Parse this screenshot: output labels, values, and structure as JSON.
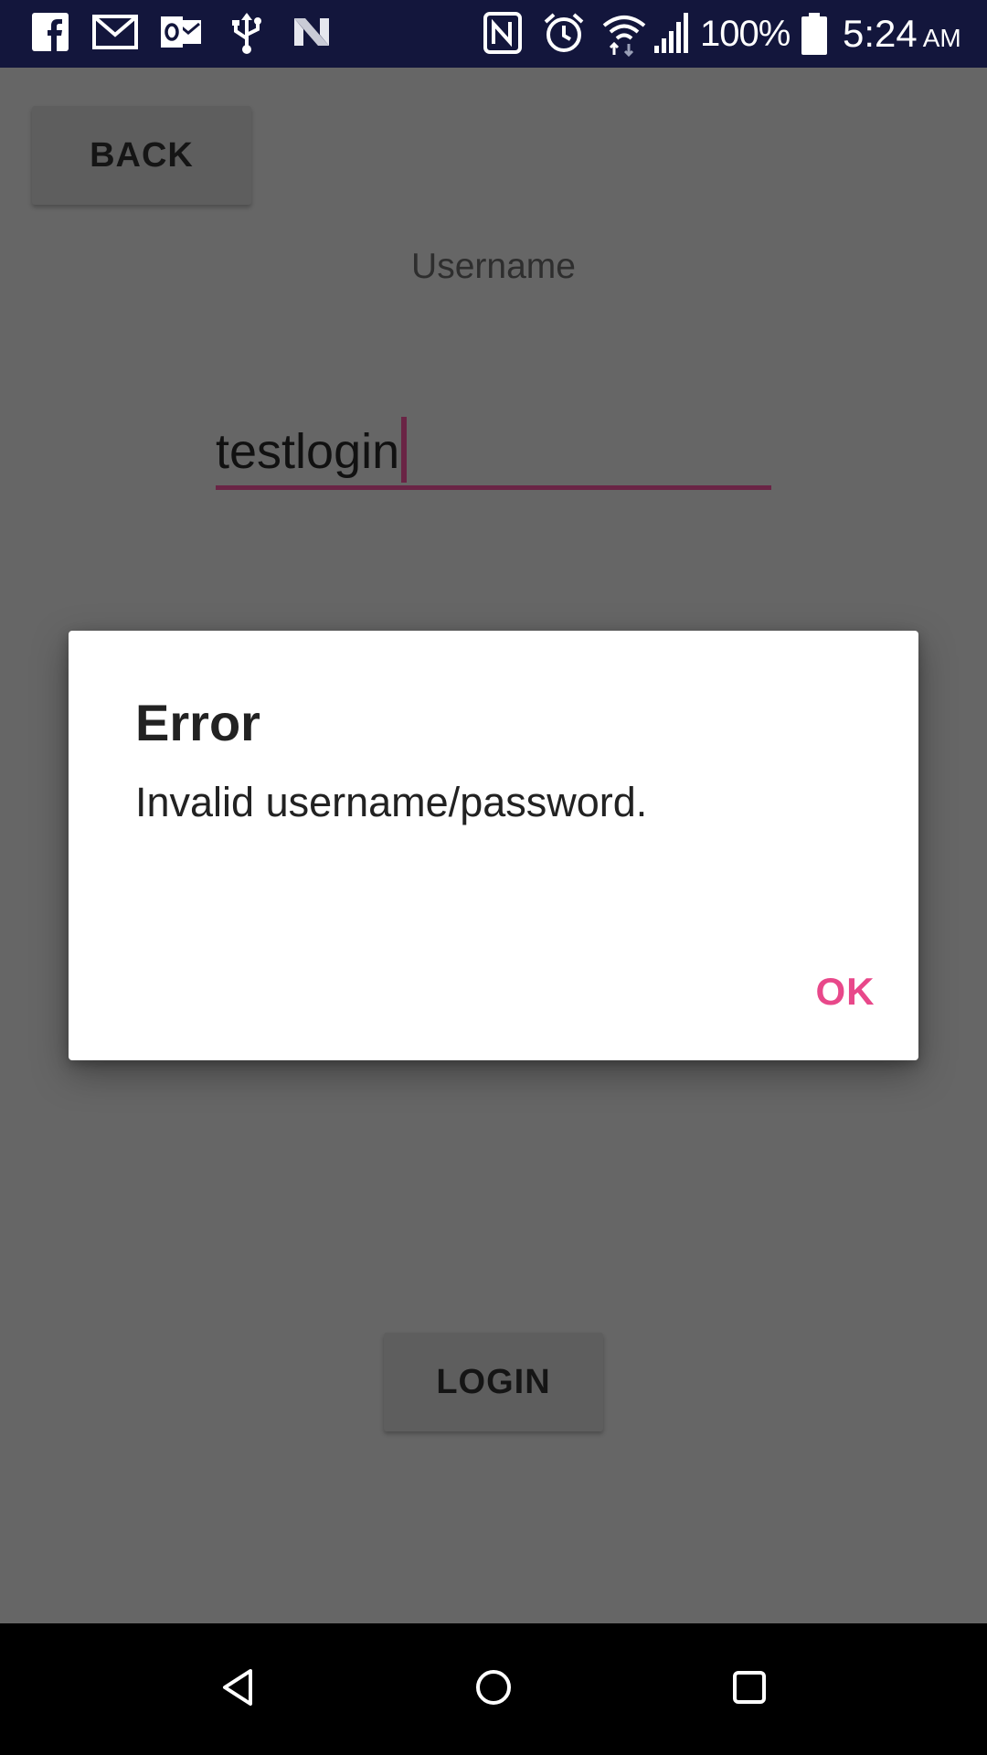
{
  "status_bar": {
    "left_icons": [
      "facebook-icon",
      "gmail-icon",
      "outlook-icon",
      "usb-icon",
      "n-app-icon"
    ],
    "right_icons": [
      "nfc-icon",
      "alarm-icon",
      "wifi-icon",
      "signal-icon",
      "battery-icon"
    ],
    "battery_percent": "100%",
    "clock_time": "5:24",
    "clock_ampm": "AM"
  },
  "app": {
    "back_label": "BACK",
    "username_label": "Username",
    "username_value": "testlogin",
    "login_label": "LOGIN"
  },
  "dialog": {
    "title": "Error",
    "message": "Invalid username/password.",
    "ok_label": "OK"
  },
  "nav_bar": {
    "buttons": [
      "back-triangle-icon",
      "home-circle-icon",
      "recents-square-icon"
    ]
  },
  "colors": {
    "status_bar_bg": "#13163c",
    "scrim_bg": "#666666",
    "accent_pink": "#e8488a",
    "field_underline": "#6a2445"
  }
}
